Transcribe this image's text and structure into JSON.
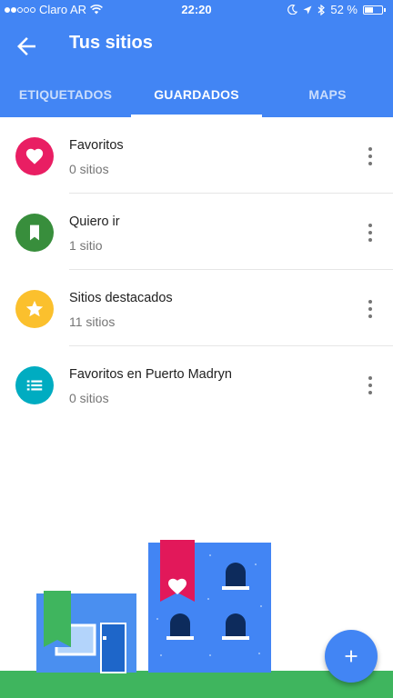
{
  "status_bar": {
    "carrier": "Claro AR",
    "time": "22:20",
    "battery": "52 %",
    "battery_level": 0.52
  },
  "header": {
    "title": "Tus sitios",
    "color": "#4285f4"
  },
  "tabs": [
    {
      "label": "ETIQUETADOS",
      "active": false
    },
    {
      "label": "GUARDADOS",
      "active": true
    },
    {
      "label": "MAPS",
      "active": false
    }
  ],
  "lists": [
    {
      "title": "Favoritos",
      "count": "0 sitios",
      "icon": "heart-icon",
      "color": "#e91e63"
    },
    {
      "title": "Quiero ir",
      "count": "1 sitio",
      "icon": "bookmark-icon",
      "color": "#388e3c"
    },
    {
      "title": "Sitios destacados",
      "count": "11 sitios",
      "icon": "star-icon",
      "color": "#fbc02d"
    },
    {
      "title": "Favoritos en Puerto Madryn",
      "count": "0 sitios",
      "icon": "list-icon",
      "color": "#00acc1"
    }
  ],
  "fab": {
    "icon": "plus-icon"
  }
}
